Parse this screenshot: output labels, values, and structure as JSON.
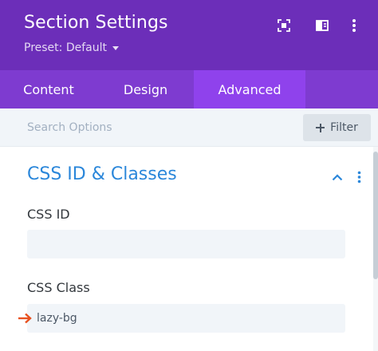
{
  "header": {
    "title": "Section Settings",
    "preset_label": "Preset: Default",
    "icons": [
      "screen-capture-icon",
      "sidebar-layout-icon",
      "more-vertical-icon"
    ],
    "background": "#6c2eb9"
  },
  "tabs": [
    {
      "label": "Content",
      "active": false
    },
    {
      "label": "Design",
      "active": false
    },
    {
      "label": "Advanced",
      "active": true
    }
  ],
  "search": {
    "placeholder": "Search Options",
    "value": "",
    "filter_label": "Filter"
  },
  "section": {
    "title": "CSS ID & Classes",
    "expanded": true,
    "title_color": "#2b87da"
  },
  "fields": {
    "css_id": {
      "label": "CSS ID",
      "value": ""
    },
    "css_class": {
      "label": "CSS Class",
      "value": "lazy-bg"
    }
  },
  "annotation": {
    "icon": "orange-arrow-icon",
    "color": "#e8511f"
  },
  "colors": {
    "header": "#6c2eb9",
    "tab_bar": "#7e3bd0",
    "active_tab": "#8f42ec",
    "accent_blue": "#2b87da",
    "field_bg": "#f1f5f9"
  }
}
